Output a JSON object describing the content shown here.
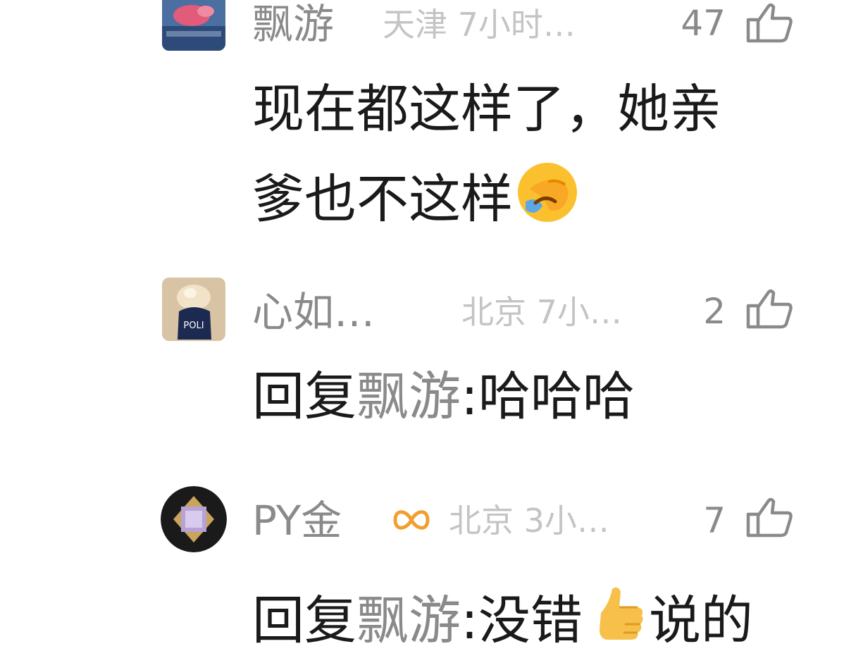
{
  "comments": [
    {
      "user": "飘游",
      "meta": "天津 7小时…",
      "likes": "47",
      "text": "现在都这样了，她亲",
      "text2": "爹也不这样",
      "emoji_icon": "rolling-laughing-face-icon"
    },
    {
      "user": "心如…",
      "meta": "北京 7小…",
      "likes": "2",
      "reply_prefix": "回复",
      "reply_to": "飘游",
      "reply_text": ":哈哈哈"
    },
    {
      "user": "PY金",
      "badge_icon": "infinity-badge-icon",
      "meta": "北京 3小…",
      "likes": "7",
      "reply_prefix": "回复",
      "reply_to": "飘游",
      "reply_text": ":没错",
      "emoji_icon": "thumbs-up-emoji-icon",
      "reply_text2": "说的"
    }
  ],
  "colors": {
    "name": "#8a8a8a",
    "meta": "#c4c4c4",
    "text": "#1a1a1a",
    "badge": "#f0a030"
  }
}
